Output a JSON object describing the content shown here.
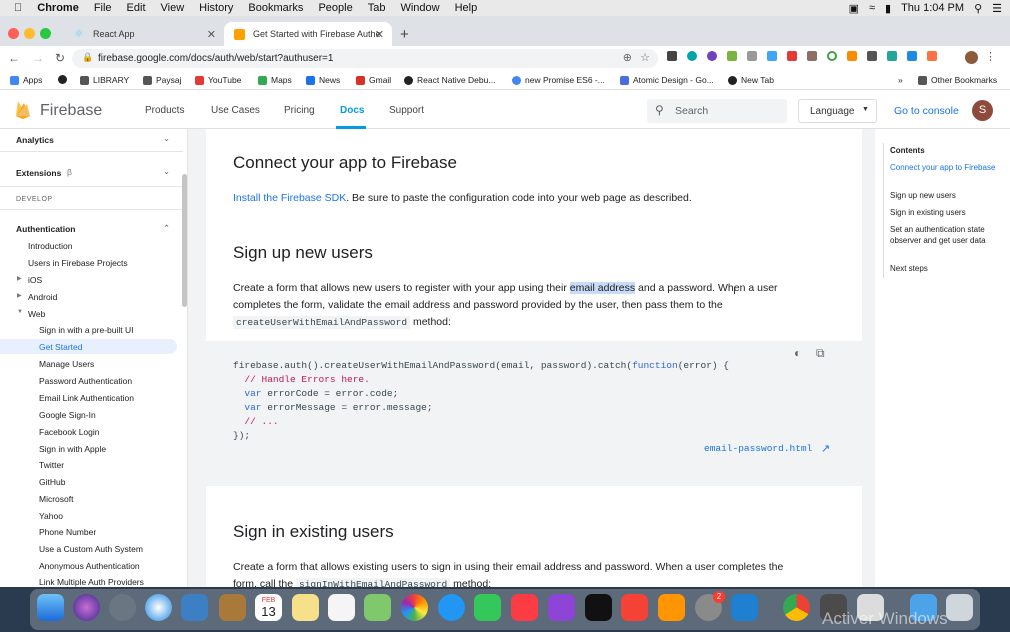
{
  "menubar": {
    "app": "Chrome",
    "items": [
      "File",
      "Edit",
      "View",
      "History",
      "Bookmarks",
      "People",
      "Tab",
      "Window",
      "Help"
    ],
    "clock": "Thu 1:04 PM"
  },
  "tabs": [
    {
      "label": "React App"
    },
    {
      "label": "Get Started with Firebase Authe"
    }
  ],
  "omnibox": {
    "url": "firebase.google.com/docs/auth/web/start?authuser=1"
  },
  "bookmarks": [
    {
      "label": "Apps"
    },
    {
      "label": ""
    },
    {
      "label": "LIBRARY"
    },
    {
      "label": "Paysaj"
    },
    {
      "label": "YouTube"
    },
    {
      "label": "Maps"
    },
    {
      "label": "News"
    },
    {
      "label": "Gmail"
    },
    {
      "label": "React Native Debu..."
    },
    {
      "label": "new Promise ES6 -..."
    },
    {
      "label": "Atomic Design - Go..."
    },
    {
      "label": "New Tab"
    },
    {
      "label": "»"
    },
    {
      "label": "Other Bookmarks"
    }
  ],
  "header": {
    "brand": "Firebase",
    "nav": [
      "Products",
      "Use Cases",
      "Pricing",
      "Docs",
      "Support"
    ],
    "search_placeholder": "Search",
    "language": "Language",
    "console": "Go to console",
    "avatar": "S"
  },
  "sidebar": {
    "analytics": "Analytics",
    "extensions": "Extensions",
    "extensions_badge": "β",
    "develop": "DEVELOP",
    "authentication": "Authentication",
    "items": [
      "Introduction",
      "Users in Firebase Projects",
      "iOS",
      "Android",
      "Web",
      "Sign in with a pre-built UI",
      "Get Started",
      "Manage Users",
      "Password Authentication",
      "Email Link Authentication",
      "Google Sign-In",
      "Facebook Login",
      "Sign in with Apple",
      "Twitter",
      "GitHub",
      "Microsoft",
      "Yahoo",
      "Phone Number",
      "Use a Custom Auth System",
      "Anonymous Authentication",
      "Link Multiple Auth Providers"
    ]
  },
  "content": {
    "h_connect": "Connect your app to Firebase",
    "install_link": "Install the Firebase SDK",
    "install_rest": ". Be sure to paste the configuration code into your web page as described.",
    "h_signup": "Sign up new users",
    "signup_p1a": "Create a form that allows new users to register with your app using their ",
    "signup_highlight": "email address",
    "signup_p1b": " and a password. When a user",
    "signup_p2": "completes the form, validate the email address and password provided by the user, then pass them to the",
    "signup_code": "createUserWithEmailAndPassword",
    "signup_p3": " method:",
    "code_lines": [
      "firebase.auth().createUserWithEmailAndPassword(email, password).catch(function(error) {",
      "  // Handle Errors here.",
      "  var errorCode = error.code;",
      "  var errorMessage = error.message;",
      "  // ...",
      "});"
    ],
    "code_file": "email-password.html",
    "h_signin": "Sign in existing users",
    "signin_p1": "Create a form that allows existing users to sign in using their email address and password. When a user completes the",
    "signin_p2a": "form, call the ",
    "signin_code": "signInWithEmailAndPassword",
    "signin_p2b": " method:"
  },
  "toc": {
    "title": "Contents",
    "items": [
      "Connect your app to Firebase",
      "Sign up new users",
      "Sign in existing users",
      "Set an authentication state observer and get user data",
      "Next steps"
    ]
  },
  "dock": {
    "calendar_month": "FEB",
    "calendar_day": "13",
    "badge": "2",
    "watermark": "Activer Windows"
  }
}
